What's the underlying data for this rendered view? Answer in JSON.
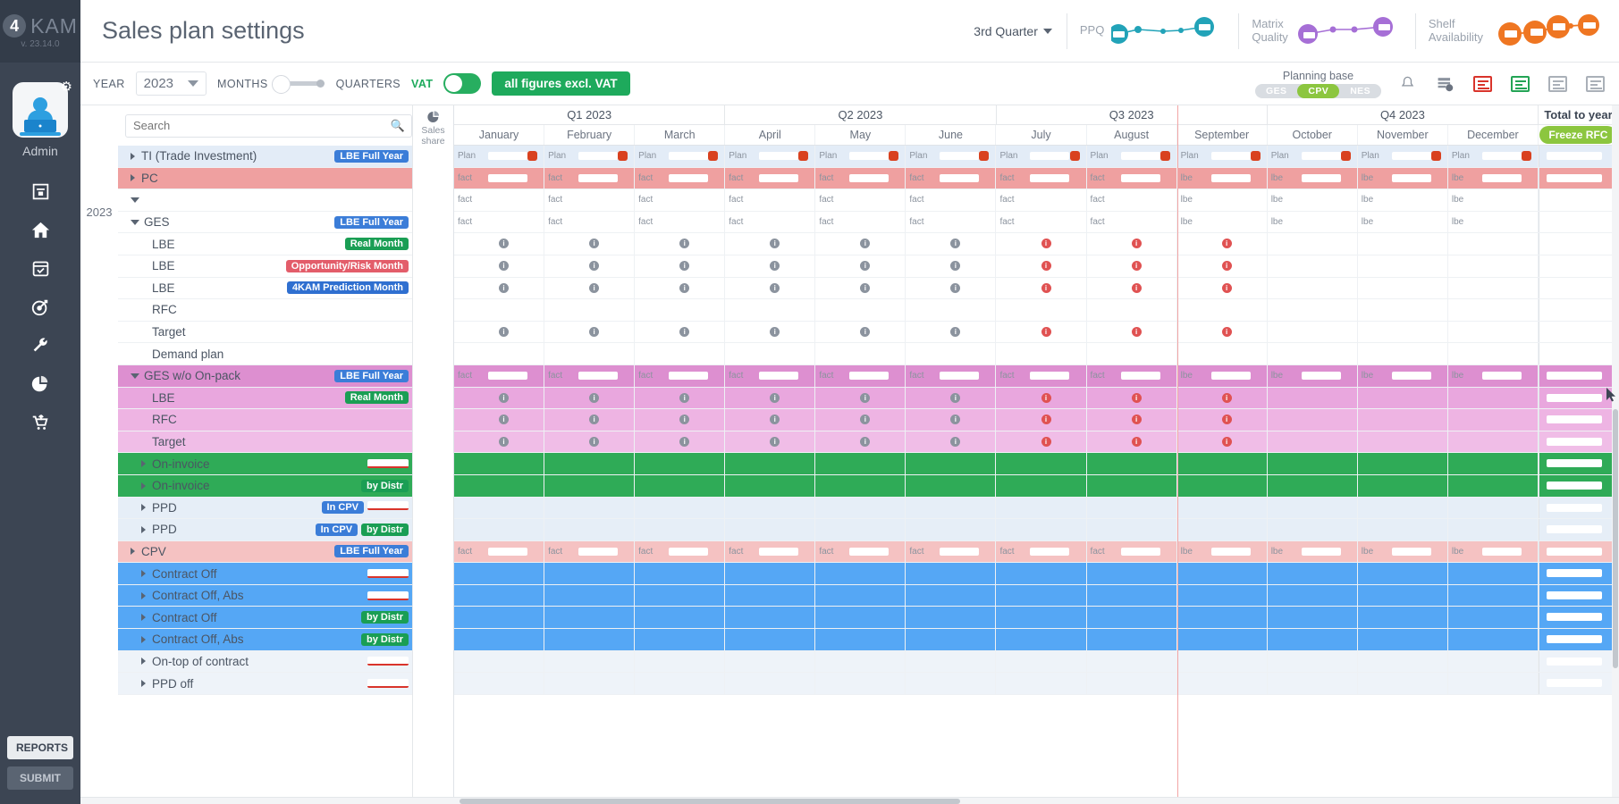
{
  "brand": {
    "logo": "4",
    "name": "KAM",
    "version": "v. 23.14.0"
  },
  "sidebar": {
    "admin_label": "Admin",
    "gear_icon": "gear-icon",
    "items": [
      {
        "name": "sidebar-item-archive",
        "icon": "archive-icon"
      },
      {
        "name": "sidebar-item-home",
        "icon": "home-icon"
      },
      {
        "name": "sidebar-item-calendar",
        "icon": "calendar-check-icon"
      },
      {
        "name": "sidebar-item-target",
        "icon": "target-icon"
      },
      {
        "name": "sidebar-item-tools",
        "icon": "wrench-icon"
      },
      {
        "name": "sidebar-item-analytics",
        "icon": "pie-chart-icon"
      },
      {
        "name": "sidebar-item-orders",
        "icon": "cart-upload-icon"
      }
    ],
    "reports_label": "REPORTS",
    "submit_label": "SUBMIT"
  },
  "header": {
    "title": "Sales plan settings",
    "quarter_selector": "3rd Quarter",
    "kpis": [
      {
        "label": "PPQ",
        "color": "#22a3b8",
        "trend": "up"
      },
      {
        "label": "Matrix\nQuality",
        "color": "#a66fd6",
        "trend": "down"
      },
      {
        "label": "Shelf\nAvailability",
        "color": "#ef7622",
        "trend": "down"
      }
    ]
  },
  "toolbar": {
    "year_label": "YEAR",
    "year_value": "2023",
    "months_label": "MONTHS",
    "quarters_label": "QUARTERS",
    "vat_label": "VAT",
    "vat_note": "all figures excl. VAT",
    "planning_base_label": "Planning base",
    "planning_base_options": [
      "GES",
      "CPV",
      "NES"
    ],
    "planning_base_active": "CPV",
    "icons": [
      {
        "name": "bell-icon"
      },
      {
        "name": "data-settings-icon"
      },
      {
        "name": "report-red-icon",
        "color": "#d9342b"
      },
      {
        "name": "report-green-icon",
        "color": "#23a455"
      },
      {
        "name": "report-gray-icon",
        "color": "#aab0b8"
      },
      {
        "name": "report-gray2-icon",
        "color": "#aab0b8"
      }
    ]
  },
  "grid": {
    "search_placeholder": "Search",
    "sales_share_label": "Sales\nshare",
    "year_marker": "2023",
    "total_title": "Total to year",
    "freeze_button": "Freeze RFC",
    "quarters": [
      {
        "label": "Q1 2023",
        "months": [
          "January",
          "February",
          "March"
        ]
      },
      {
        "label": "Q2 2023",
        "months": [
          "April",
          "May",
          "June"
        ]
      },
      {
        "label": "Q3 2023",
        "months": [
          "July",
          "August",
          "September"
        ]
      },
      {
        "label": "Q4 2023",
        "months": [
          "October",
          "November",
          "December"
        ]
      }
    ],
    "cell_tags": {
      "plan": "Plan",
      "fact": "fact",
      "lbe": "lbe",
      "plan_lower": "plan"
    },
    "rows": [
      {
        "label": "TI (Trade Investment)",
        "indent": 1,
        "arrow": "closed",
        "badges": [
          {
            "text": "LBE Full Year",
            "style": "b-blue"
          }
        ],
        "bg": "#e3ecf7",
        "tag": "plan",
        "dots": true
      },
      {
        "label": "PC",
        "indent": 1,
        "arrow": "closed",
        "badges": [],
        "bg": "#efa0a0",
        "tag": "fact"
      },
      {
        "label": "",
        "indent": 1,
        "arrow": "open",
        "redacted": true,
        "badges": [],
        "bg": "#ffffff",
        "tag": "fact"
      },
      {
        "label": "GES",
        "indent": 1,
        "arrow": "open",
        "badges": [
          {
            "text": "LBE Full Year",
            "style": "b-blue"
          }
        ],
        "bg": "#ffffff",
        "tag": "fact"
      },
      {
        "label": "LBE",
        "indent": 2,
        "arrow": "none",
        "badges": [
          {
            "text": "Real Month",
            "style": "b-green"
          }
        ],
        "bg": "#ffffff",
        "tag": "",
        "info": true
      },
      {
        "label": "LBE",
        "indent": 2,
        "arrow": "none",
        "badges": [
          {
            "text": "Opportunity/Risk Month",
            "style": "b-red"
          }
        ],
        "bg": "#ffffff",
        "tag": "",
        "info": true
      },
      {
        "label": "LBE",
        "indent": 2,
        "arrow": "none",
        "badges": [
          {
            "text": "4KAM Prediction Month",
            "style": "b-darkblue"
          }
        ],
        "bg": "#ffffff",
        "tag": "",
        "info": true
      },
      {
        "label": "RFC",
        "indent": 2,
        "arrow": "none",
        "badges": [],
        "bg": "#ffffff"
      },
      {
        "label": "Target",
        "indent": 2,
        "arrow": "none",
        "badges": [],
        "bg": "#ffffff",
        "info": true
      },
      {
        "label": "Demand plan",
        "indent": 2,
        "arrow": "none",
        "badges": [],
        "bg": "#ffffff"
      },
      {
        "label": "GES w/o On-pack",
        "indent": 1,
        "arrow": "open",
        "badges": [
          {
            "text": "LBE Full Year",
            "style": "b-blue"
          }
        ],
        "bg": "#dd8fd0",
        "tag": "fact"
      },
      {
        "label": "LBE",
        "indent": 2,
        "arrow": "none",
        "badges": [
          {
            "text": "Real Month",
            "style": "b-green"
          }
        ],
        "bg": "#e9a7de",
        "info": true
      },
      {
        "label": "RFC",
        "indent": 2,
        "arrow": "none",
        "badges": [],
        "bg": "#eeb4e3",
        "info": true
      },
      {
        "label": "Target",
        "indent": 2,
        "arrow": "none",
        "badges": [],
        "bg": "#f0bde7",
        "info": true
      },
      {
        "label": "On-invoice",
        "indent": 2,
        "arrow": "closed",
        "badges": [
          {
            "text": "",
            "style": "redline"
          }
        ],
        "bg": "#2fab57"
      },
      {
        "label": "On-invoice",
        "indent": 2,
        "arrow": "closed",
        "badges": [
          {
            "text": "by Distr",
            "style": "b-green"
          }
        ],
        "bg": "#2fab57"
      },
      {
        "label": "PPD",
        "indent": 2,
        "arrow": "closed",
        "badges": [
          {
            "text": "In CPV",
            "style": "b-blue"
          },
          {
            "text": "",
            "style": "redline"
          }
        ],
        "bg": "#e6eef7"
      },
      {
        "label": "PPD",
        "indent": 2,
        "arrow": "closed",
        "badges": [
          {
            "text": "In CPV",
            "style": "b-blue"
          },
          {
            "text": "by Distr",
            "style": "b-green"
          }
        ],
        "bg": "#e6eef7"
      },
      {
        "label": "CPV",
        "indent": 1,
        "arrow": "closed",
        "badges": [
          {
            "text": "LBE Full Year",
            "style": "b-blue"
          }
        ],
        "bg": "#f5c2c2",
        "tag": "fact"
      },
      {
        "label": "Contract Off",
        "indent": 2,
        "arrow": "closed",
        "badges": [
          {
            "text": "",
            "style": "redline"
          }
        ],
        "bg": "#55a7f5"
      },
      {
        "label": "Contract Off, Abs",
        "indent": 2,
        "arrow": "closed",
        "badges": [
          {
            "text": "",
            "style": "redline"
          }
        ],
        "bg": "#55a7f5"
      },
      {
        "label": "Contract Off",
        "indent": 2,
        "arrow": "closed",
        "badges": [
          {
            "text": "by Distr",
            "style": "b-green"
          }
        ],
        "bg": "#55a7f5"
      },
      {
        "label": "Contract Off, Abs",
        "indent": 2,
        "arrow": "closed",
        "badges": [
          {
            "text": "by Distr",
            "style": "b-green"
          }
        ],
        "bg": "#55a7f5"
      },
      {
        "label": "On-top of contract",
        "indent": 2,
        "arrow": "closed",
        "badges": [
          {
            "text": "",
            "style": "redline"
          }
        ],
        "bg": "#eef3f9"
      },
      {
        "label": "PPD off",
        "indent": 2,
        "arrow": "closed",
        "badges": [
          {
            "text": "",
            "style": "redline"
          }
        ],
        "bg": "#eef3f9"
      }
    ]
  }
}
